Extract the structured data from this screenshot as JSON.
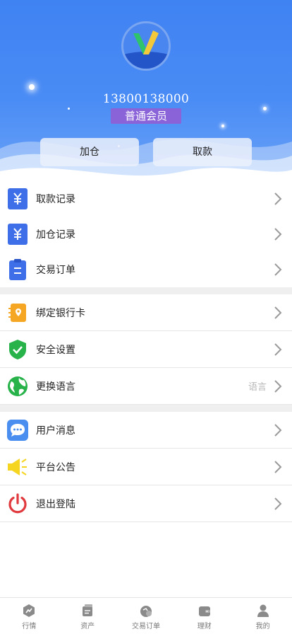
{
  "header": {
    "phone": "13800138000",
    "member_level": "普通会员",
    "buttons": {
      "add_position": "加仓",
      "withdraw": "取款"
    }
  },
  "menu": {
    "group1": [
      {
        "label": "取款记录",
        "icon": "yen-document-icon"
      },
      {
        "label": "加仓记录",
        "icon": "yen-document-icon"
      },
      {
        "label": "交易订单",
        "icon": "clipboard-icon"
      }
    ],
    "group2": [
      {
        "label": "绑定银行卡",
        "icon": "bank-card-icon"
      },
      {
        "label": "安全设置",
        "icon": "shield-check-icon"
      },
      {
        "label": "更换语言",
        "icon": "globe-icon",
        "hint": "语言"
      }
    ],
    "group3": [
      {
        "label": "用户消息",
        "icon": "chat-bubble-icon"
      },
      {
        "label": "平台公告",
        "icon": "megaphone-icon"
      },
      {
        "label": "退出登陆",
        "icon": "power-icon"
      }
    ]
  },
  "tabbar": [
    {
      "label": "行情",
      "icon": "market-icon"
    },
    {
      "label": "资产",
      "icon": "assets-icon"
    },
    {
      "label": "交易订单",
      "icon": "order-icon"
    },
    {
      "label": "理财",
      "icon": "wallet-icon"
    },
    {
      "label": "我的",
      "icon": "profile-icon"
    }
  ],
  "colors": {
    "header_blue": "#4a8cf5",
    "badge_purple": "#8a63d8",
    "icon_blue": "#3e6ee8",
    "orange": "#f5a623",
    "green": "#27b24a",
    "red": "#e0393e"
  }
}
